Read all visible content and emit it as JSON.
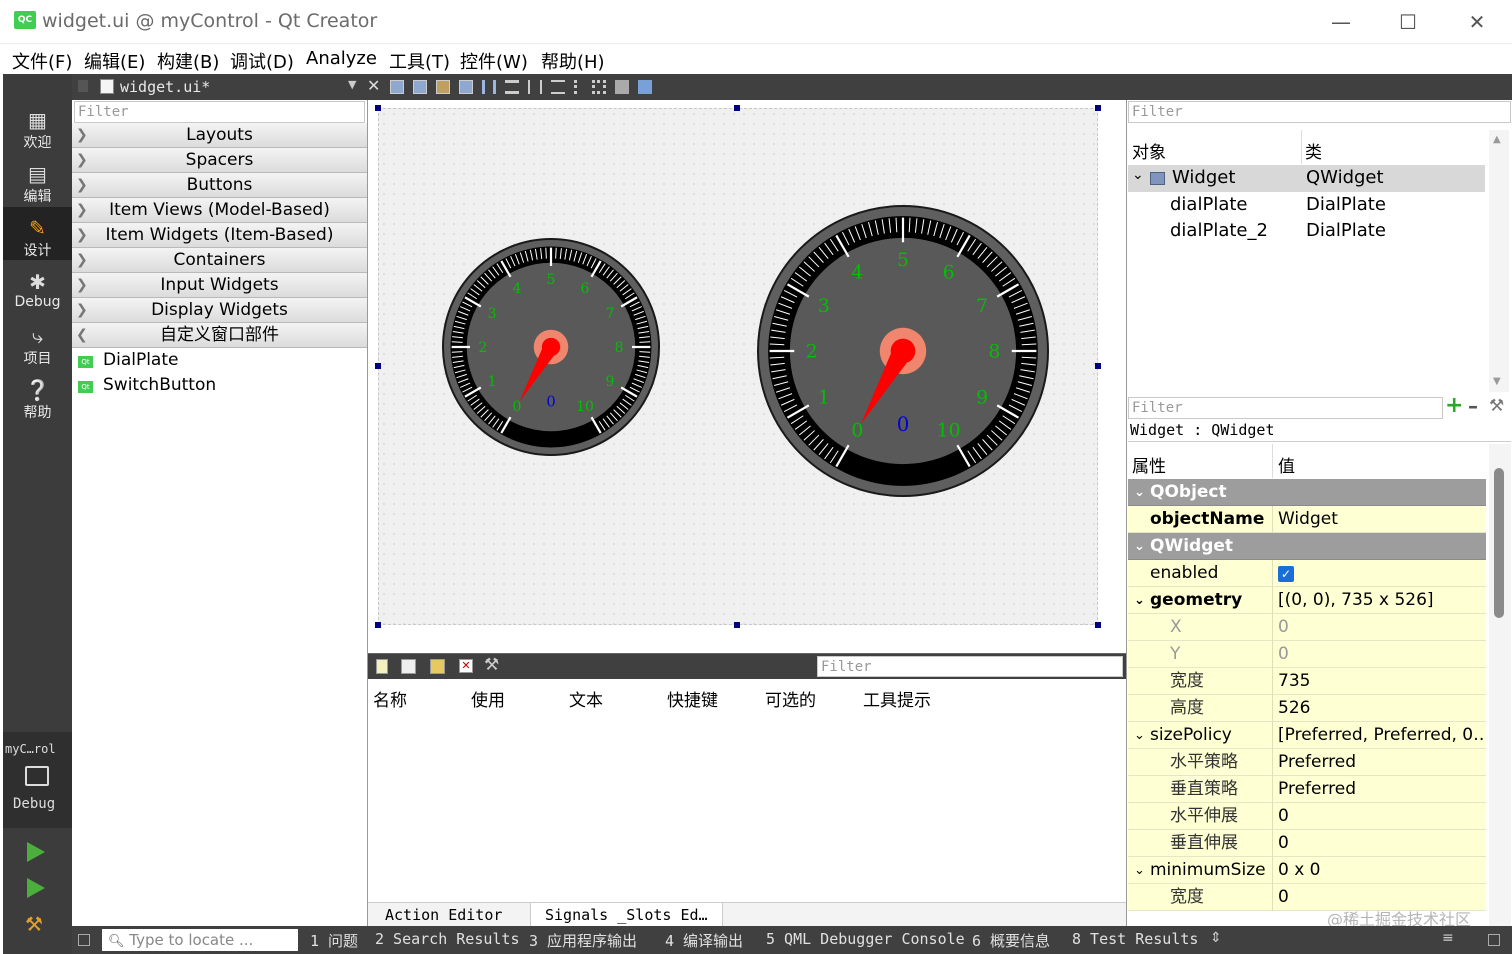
{
  "window": {
    "title": "widget.ui @ myControl - Qt Creator",
    "app_icon": "QC"
  },
  "menu": [
    "文件(F)",
    "编辑(E)",
    "构建(B)",
    "调试(D)",
    "Analyze",
    "工具(T)",
    "控件(W)",
    "帮助(H)"
  ],
  "modes": [
    {
      "label": "欢迎",
      "icon": "grid-icon"
    },
    {
      "label": "编辑",
      "icon": "document-icon"
    },
    {
      "label": "设计",
      "icon": "pencil-icon",
      "selected": true
    },
    {
      "label": "Debug",
      "icon": "bug-icon"
    },
    {
      "label": "项目",
      "icon": "wrench-icon"
    },
    {
      "label": "帮助",
      "icon": "help-icon"
    }
  ],
  "kit": {
    "label": "myC…rol",
    "mode": "Debug"
  },
  "document": {
    "filename": "widget.ui*"
  },
  "widgetbox": {
    "filter_placeholder": "Filter",
    "categories": [
      "Layouts",
      "Spacers",
      "Buttons",
      "Item Views (Model-Based)",
      "Item Widgets (Item-Based)",
      "Containers",
      "Input Widgets",
      "Display Widgets",
      "自定义窗口部件"
    ],
    "custom_items": [
      "DialPlate",
      "SwitchButton"
    ]
  },
  "dials": {
    "labels": [
      "0",
      "1",
      "2",
      "3",
      "4",
      "5",
      "6",
      "7",
      "8",
      "9",
      "10"
    ],
    "value_label": "0",
    "colors": {
      "outer": "#5f5f5f",
      "ring": "#000000",
      "face": "#595959",
      "numbers": "#00c000",
      "value": "#0000dd",
      "needle": "#ff0000",
      "center": "#f0866e"
    }
  },
  "action_editor": {
    "filter_placeholder": "Filter",
    "columns": [
      "名称",
      "使用",
      "文本",
      "快捷键",
      "可选的",
      "工具提示"
    ],
    "tabs": [
      "Action Editor",
      "Signals _Slots Ed…"
    ]
  },
  "object_inspector": {
    "filter_placeholder": "Filter",
    "columns": [
      "对象",
      "类"
    ],
    "rows": [
      {
        "object": "Widget",
        "class": "QWidget"
      },
      {
        "object": "dialPlate",
        "class": "DialPlate"
      },
      {
        "object": "dialPlate_2",
        "class": "DialPlate"
      }
    ]
  },
  "property_editor": {
    "filter_placeholder": "Filter",
    "context": "Widget : QWidget",
    "columns": [
      "属性",
      "值"
    ],
    "rows": [
      {
        "name": "QObject",
        "value": "",
        "kind": "group"
      },
      {
        "name": "objectName",
        "value": "Widget",
        "kind": "bold"
      },
      {
        "name": "QWidget",
        "value": "",
        "kind": "group"
      },
      {
        "name": "enabled",
        "value": "",
        "kind": "check",
        "checked": true
      },
      {
        "name": "geometry",
        "value": "[(0, 0), 735 x 526]",
        "kind": "boldexp"
      },
      {
        "name": "X",
        "value": "0",
        "kind": "subdis"
      },
      {
        "name": "Y",
        "value": "0",
        "kind": "subdis"
      },
      {
        "name": "宽度",
        "value": "735",
        "kind": "sub"
      },
      {
        "name": "高度",
        "value": "526",
        "kind": "sub"
      },
      {
        "name": "sizePolicy",
        "value": "[Preferred, Preferred, 0…",
        "kind": "exp"
      },
      {
        "name": "水平策略",
        "value": "Preferred",
        "kind": "sub"
      },
      {
        "name": "垂直策略",
        "value": "Preferred",
        "kind": "sub"
      },
      {
        "name": "水平伸展",
        "value": "0",
        "kind": "sub"
      },
      {
        "name": "垂直伸展",
        "value": "0",
        "kind": "sub"
      },
      {
        "name": "minimumSize",
        "value": "0 x 0",
        "kind": "exp"
      },
      {
        "name": "宽度",
        "value": "0",
        "kind": "sub"
      }
    ]
  },
  "statusbar": {
    "locate_placeholder": "Type to locate ...",
    "items": [
      "1 问题",
      "2 Search Results",
      "3 应用程序输出",
      "4 编译输出",
      "5 QML Debugger Console",
      "6 概要信息",
      "8 Test Results"
    ]
  },
  "watermark": "@稀土掘金技术社区"
}
